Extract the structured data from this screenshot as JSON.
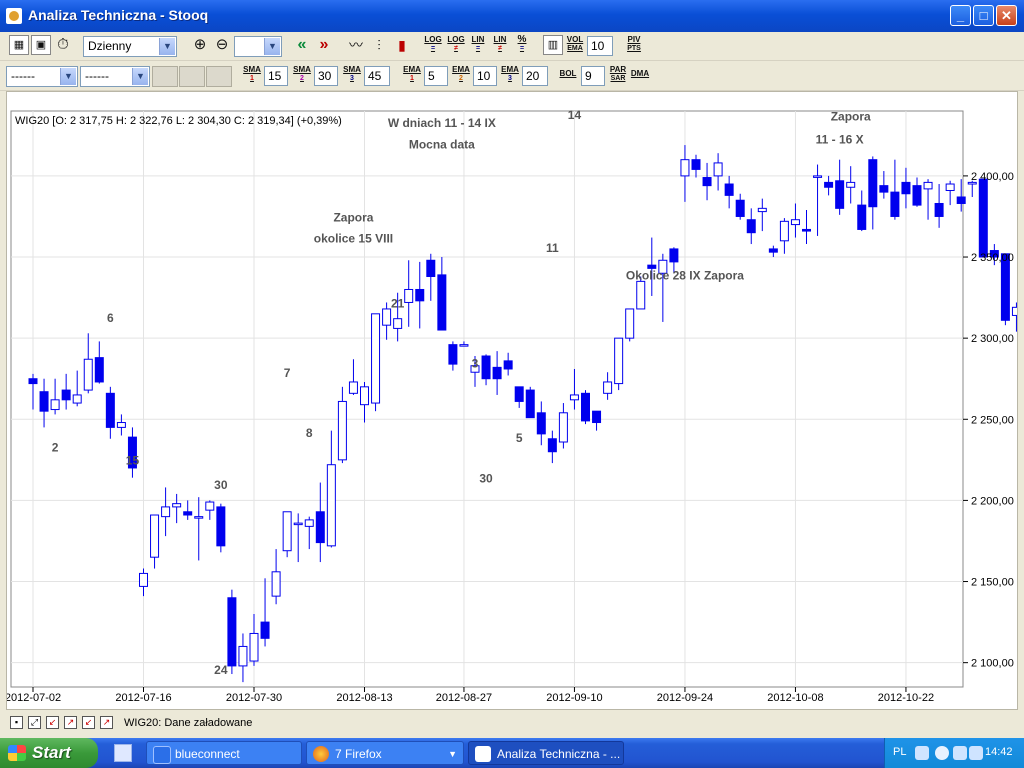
{
  "window": {
    "title": "Analiza Techniczna - Stooq"
  },
  "toolbar1": {
    "period_select": "Dzienny",
    "vol_ema_label_top": "VOL",
    "vol_ema_label_bottom": "EMA",
    "vol_ema_value": "10",
    "piv_pts_top": "PIV",
    "piv_pts_bottom": "PTS",
    "log_labels": [
      "LOG",
      "LOG",
      "LIN",
      "LIN"
    ],
    "log_subs": [
      "=",
      "≠",
      "=",
      "≠"
    ],
    "percent_label": "%"
  },
  "toolbar2": {
    "select1": "------",
    "select2": "------",
    "indicators": [
      {
        "label": "SMA",
        "index": "1",
        "value": "15"
      },
      {
        "label": "SMA",
        "index": "2",
        "value": "30"
      },
      {
        "label": "SMA",
        "index": "3",
        "value": "45"
      },
      {
        "label": "EMA",
        "index": "1",
        "value": "5"
      },
      {
        "label": "EMA",
        "index": "2",
        "value": "10"
      },
      {
        "label": "EMA",
        "index": "3",
        "value": "20"
      },
      {
        "label": "BOL",
        "index": "",
        "value": "9"
      }
    ],
    "parsar_top": "PAR",
    "parsar_bottom": "SAR",
    "dma_label": "DMA"
  },
  "status": {
    "text": "WIG20: Dane załadowane"
  },
  "taskbar": {
    "start_label": "Start",
    "buttons": [
      {
        "label": "blueconnect"
      },
      {
        "label": "7 Firefox"
      },
      {
        "label": "Analiza Techniczna - ..."
      }
    ],
    "lang": "PL",
    "clock": "14:42"
  },
  "chart_data": {
    "type": "candlestick",
    "info": "WIG20 [O: 2 317,75  H: 2 322,76  L: 2 304,30  C: 2 319,34] (+0,39%)",
    "ylim": [
      2085,
      2440
    ],
    "y_ticks": [
      2100,
      2150,
      2200,
      2250,
      2300,
      2350,
      2400
    ],
    "y_tick_labels": [
      "2 100,00",
      "2 150,00",
      "2 200,00",
      "2 250,00",
      "2 300,00",
      "2 350,00",
      "2 400,00"
    ],
    "x_ticks": [
      {
        "label": "2012-07-02",
        "bar": 0
      },
      {
        "label": "2012-07-16",
        "bar": 10
      },
      {
        "label": "2012-07-30",
        "bar": 20
      },
      {
        "label": "2012-08-13",
        "bar": 30
      },
      {
        "label": "2012-08-27",
        "bar": 39
      },
      {
        "label": "2012-09-10",
        "bar": 49
      },
      {
        "label": "2012-09-24",
        "bar": 59
      },
      {
        "label": "2012-10-08",
        "bar": 69
      },
      {
        "label": "2012-10-22",
        "bar": 79
      }
    ],
    "candles": [
      [
        2275,
        2278,
        2256,
        2272
      ],
      [
        2267,
        2275,
        2245,
        2255
      ],
      [
        2256,
        2275,
        2253,
        2262
      ],
      [
        2268,
        2278,
        2256,
        2262
      ],
      [
        2260,
        2280,
        2258,
        2265
      ],
      [
        2268,
        2303,
        2266,
        2287
      ],
      [
        2288,
        2298,
        2272,
        2273
      ],
      [
        2266,
        2270,
        2238,
        2245
      ],
      [
        2245,
        2253,
        2240,
        2248
      ],
      [
        2239,
        2245,
        2214,
        2220
      ],
      [
        2147,
        2158,
        2141,
        2155
      ],
      [
        2165,
        2185,
        2158,
        2191
      ],
      [
        2190,
        2208,
        2178,
        2196
      ],
      [
        2196,
        2204,
        2186,
        2198
      ],
      [
        2193,
        2200,
        2188,
        2191
      ],
      [
        2190,
        2202,
        2163,
        2190
      ],
      [
        2194,
        2200,
        2188,
        2199
      ],
      [
        2196,
        2198,
        2168,
        2172
      ],
      [
        2140,
        2145,
        2093,
        2098
      ],
      [
        2098,
        2118,
        2088,
        2110
      ],
      [
        2101,
        2130,
        2098,
        2118
      ],
      [
        2125,
        2152,
        2110,
        2115
      ],
      [
        2141,
        2170,
        2136,
        2156
      ],
      [
        2169,
        2192,
        2165,
        2193
      ],
      [
        2186,
        2192,
        2162,
        2186
      ],
      [
        2184,
        2190,
        2170,
        2188
      ],
      [
        2193,
        2211,
        2162,
        2174
      ],
      [
        2172,
        2243,
        2171,
        2222
      ],
      [
        2225,
        2270,
        2223,
        2261
      ],
      [
        2266,
        2287,
        2265,
        2273
      ],
      [
        2259,
        2273,
        2248,
        2270
      ],
      [
        2260,
        2297,
        2255,
        2315
      ],
      [
        2308,
        2322,
        2299,
        2318
      ],
      [
        2306,
        2328,
        2298,
        2312
      ],
      [
        2322,
        2348,
        2307,
        2330
      ],
      [
        2330,
        2347,
        2306,
        2323
      ],
      [
        2348,
        2352,
        2323,
        2338
      ],
      [
        2339,
        2350,
        2305,
        2305
      ],
      [
        2296,
        2298,
        2280,
        2284
      ],
      [
        2296,
        2298,
        2296,
        2296
      ],
      [
        2279,
        2289,
        2270,
        2283
      ],
      [
        2289,
        2290,
        2271,
        2275
      ],
      [
        2282,
        2292,
        2265,
        2275
      ],
      [
        2286,
        2291,
        2277,
        2281
      ],
      [
        2270,
        2263,
        2257,
        2261
      ],
      [
        2268,
        2270,
        2255,
        2251
      ],
      [
        2254,
        2261,
        2234,
        2241
      ],
      [
        2238,
        2243,
        2223,
        2230
      ],
      [
        2236,
        2260,
        2232,
        2254
      ],
      [
        2262,
        2281,
        2256,
        2265
      ],
      [
        2266,
        2268,
        2247,
        2249
      ],
      [
        2255,
        2254,
        2243,
        2248
      ],
      [
        2266,
        2279,
        2262,
        2273
      ],
      [
        2272,
        2300,
        2268,
        2300
      ],
      [
        2300,
        2318,
        2298,
        2318
      ],
      [
        2318,
        2338,
        2318,
        2335
      ],
      [
        2345,
        2362,
        2326,
        2343
      ],
      [
        2340,
        2352,
        2310,
        2348
      ],
      [
        2355,
        2356,
        2340,
        2347
      ],
      [
        2400,
        2419,
        2384,
        2410
      ],
      [
        2410,
        2413,
        2399,
        2404
      ],
      [
        2399,
        2408,
        2385,
        2394
      ],
      [
        2400,
        2414,
        2391,
        2408
      ],
      [
        2395,
        2400,
        2380,
        2388
      ],
      [
        2385,
        2389,
        2373,
        2375
      ],
      [
        2373,
        2380,
        2358,
        2365
      ],
      [
        2378,
        2386,
        2366,
        2380
      ],
      [
        2355,
        2357,
        2350,
        2353
      ],
      [
        2360,
        2374,
        2352,
        2372
      ],
      [
        2370,
        2383,
        2362,
        2373
      ],
      [
        2367,
        2379,
        2358,
        2366
      ],
      [
        2400,
        2407,
        2363,
        2400
      ],
      [
        2396,
        2400,
        2388,
        2393
      ],
      [
        2397,
        2410,
        2376,
        2380
      ],
      [
        2393,
        2406,
        2383,
        2396
      ],
      [
        2382,
        2391,
        2366,
        2367
      ],
      [
        2410,
        2412,
        2367,
        2381
      ],
      [
        2394,
        2403,
        2386,
        2390
      ],
      [
        2390,
        2410,
        2373,
        2375
      ],
      [
        2396,
        2405,
        2380,
        2389
      ],
      [
        2394,
        2399,
        2381,
        2382
      ],
      [
        2392,
        2398,
        2373,
        2396
      ],
      [
        2383,
        2395,
        2368,
        2375
      ],
      [
        2391,
        2397,
        2382,
        2395
      ],
      [
        2387,
        2398,
        2378,
        2383
      ],
      [
        2395,
        2397,
        2387,
        2396
      ],
      [
        2398,
        2398,
        2350,
        2350
      ],
      [
        2354,
        2358,
        2345,
        2350
      ],
      [
        2352,
        2350,
        2308,
        2311
      ],
      [
        2314,
        2322,
        2304,
        2319
      ]
    ],
    "annotations": [
      {
        "text": "2",
        "bar": 2,
        "price": 2230
      },
      {
        "text": "6",
        "bar": 7,
        "price": 2310
      },
      {
        "text": "15",
        "bar": 9,
        "price": 2222
      },
      {
        "text": "30",
        "bar": 17,
        "price": 2207
      },
      {
        "text": "24",
        "bar": 17,
        "price": 2093
      },
      {
        "text": "7",
        "bar": 23,
        "price": 2276
      },
      {
        "text": "8",
        "bar": 25,
        "price": 2239
      },
      {
        "text": "Zapora",
        "bar": 29,
        "price": 2372
      },
      {
        "text": "okolice 15 VIII",
        "bar": 29,
        "price": 2359
      },
      {
        "text": "21",
        "bar": 33,
        "price": 2319
      },
      {
        "text": "W dniach 11 - 14  IX",
        "bar": 37,
        "price": 2430
      },
      {
        "text": "Mocna data",
        "bar": 37,
        "price": 2417
      },
      {
        "text": "3",
        "bar": 40,
        "price": 2282
      },
      {
        "text": "30",
        "bar": 41,
        "price": 2211
      },
      {
        "text": "5",
        "bar": 44,
        "price": 2236
      },
      {
        "text": "11",
        "bar": 47,
        "price": 2353
      },
      {
        "text": "14",
        "bar": 49,
        "price": 2435
      },
      {
        "text": "Okolice 28 IX Zapora",
        "bar": 59,
        "price": 2336
      },
      {
        "text": "Zapora",
        "bar": 74,
        "price": 2434
      },
      {
        "text": "11 - 16 X",
        "bar": 73,
        "price": 2420
      }
    ]
  }
}
